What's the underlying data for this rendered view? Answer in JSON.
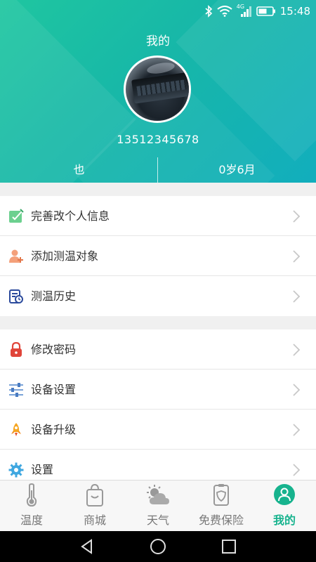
{
  "status_bar": {
    "time": "15:48",
    "network": "4G",
    "icons": [
      "bluetooth-icon",
      "wifi-icon",
      "signal-icon",
      "battery-icon"
    ]
  },
  "header": {
    "title": "我的",
    "phone": "13512345678",
    "name": "也",
    "age": "0岁6月"
  },
  "menu_groups": [
    {
      "items": [
        {
          "label": "完善改个人信息",
          "icon": "edit-profile-icon"
        },
        {
          "label": "添加测温对象",
          "icon": "add-person-icon"
        },
        {
          "label": "测温历史",
          "icon": "history-icon"
        }
      ]
    },
    {
      "items": [
        {
          "label": "修改密码",
          "icon": "lock-icon"
        },
        {
          "label": "设备设置",
          "icon": "device-settings-icon"
        },
        {
          "label": "设备升级",
          "icon": "rocket-icon"
        },
        {
          "label": "设置",
          "icon": "gear-icon"
        }
      ]
    }
  ],
  "tabbar": {
    "tabs": [
      {
        "label": "温度",
        "icon": "thermometer-icon",
        "active": false
      },
      {
        "label": "商城",
        "icon": "shopping-bag-icon",
        "active": false
      },
      {
        "label": "天气",
        "icon": "weather-icon",
        "active": false
      },
      {
        "label": "免费保险",
        "icon": "insurance-icon",
        "active": false
      },
      {
        "label": "我的",
        "icon": "profile-icon",
        "active": true
      }
    ]
  },
  "colors": {
    "header_start": "#1fc6a0",
    "header_end": "#12aebd",
    "active_tab": "#17b38e",
    "inactive_tab": "#777777"
  },
  "nav_buttons": [
    "back-icon",
    "home-icon",
    "recents-icon"
  ]
}
